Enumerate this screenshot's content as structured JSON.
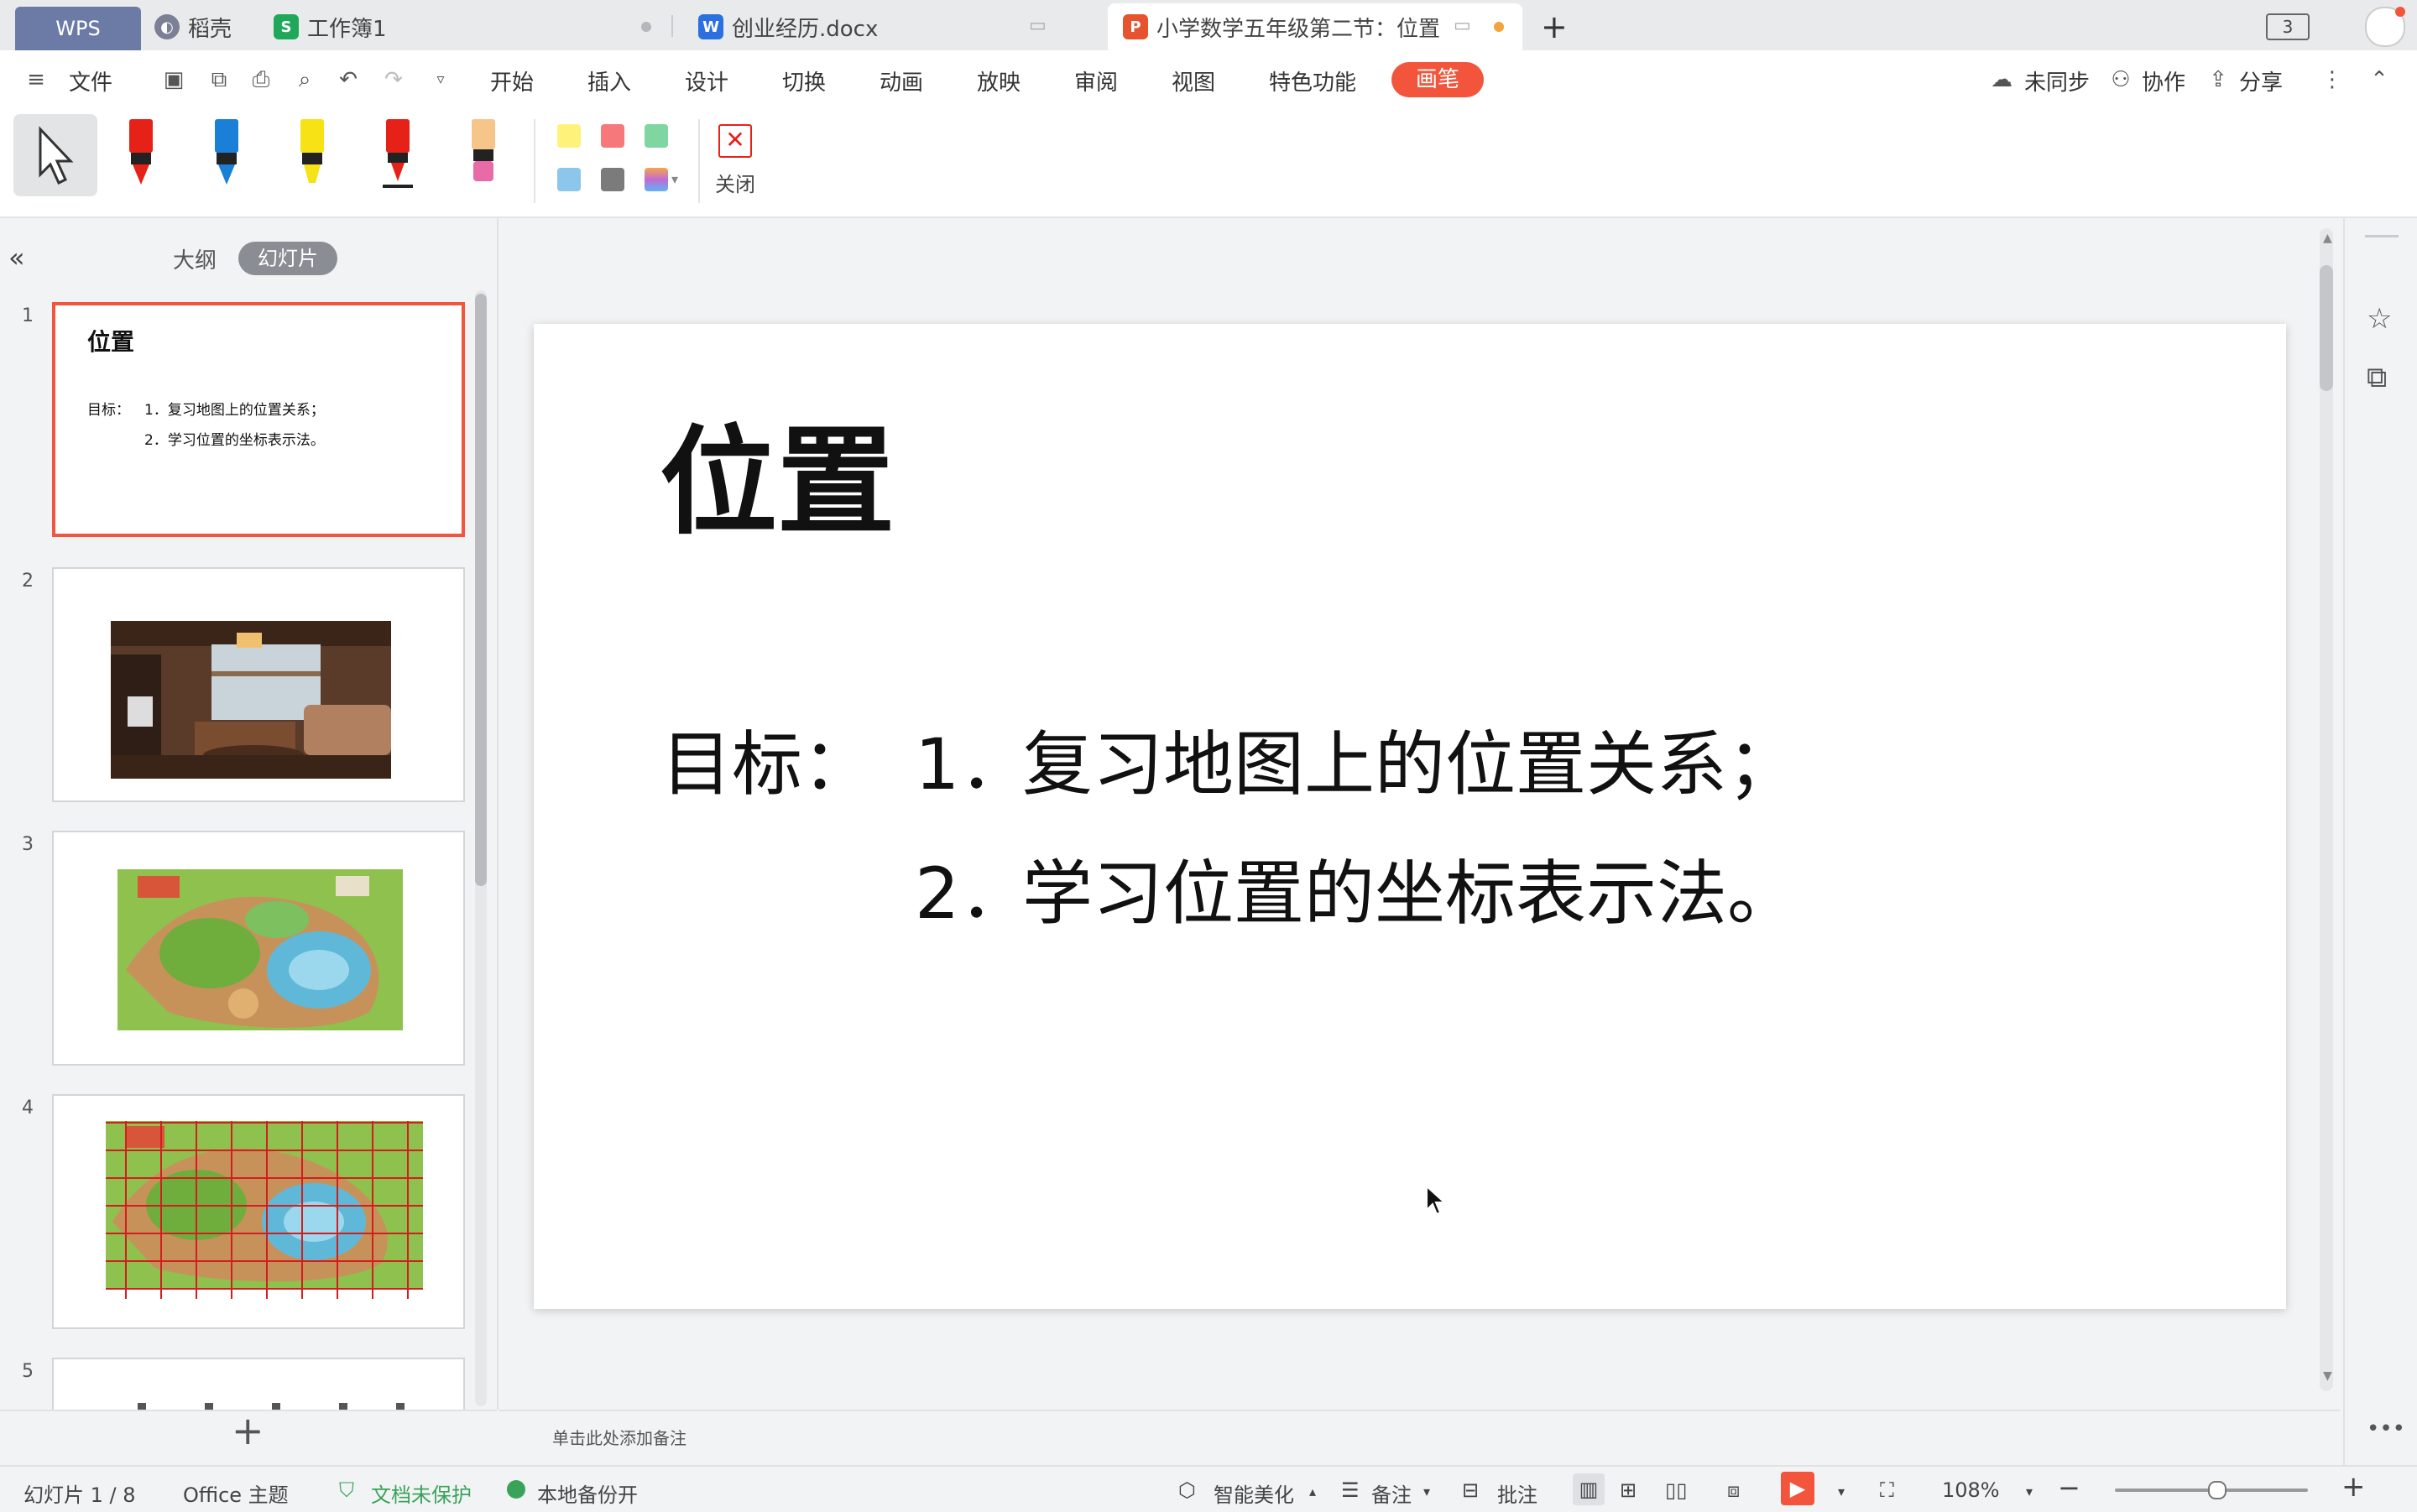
{
  "tabs": {
    "wps": "WPS",
    "daoke": "稻壳",
    "workbook": "工作簿1",
    "docx": "创业经历.docx",
    "active_doc": "小学数学五年级第二节：位置",
    "new_tab": "+",
    "window_count": "3"
  },
  "menu": {
    "file": "文件",
    "items": [
      "开始",
      "插入",
      "设计",
      "切换",
      "动画",
      "放映",
      "审阅",
      "视图",
      "特色功能"
    ],
    "pen": "画笔",
    "sync": "未同步",
    "collab": "协作",
    "share": "分享"
  },
  "ribbon": {
    "close_label": "关闭",
    "pens": [
      {
        "name": "red-marker",
        "color": "#e62117"
      },
      {
        "name": "blue-marker",
        "color": "#1a7fd6"
      },
      {
        "name": "yellow-highlighter",
        "color": "#f7e216"
      },
      {
        "name": "red-pen",
        "color": "#e62117"
      },
      {
        "name": "eraser",
        "color": "#f6c58a"
      }
    ],
    "swatches": [
      "#fff27a",
      "#f6787a",
      "#7fd6a0",
      "#8cc6ea",
      "#7b7b7b"
    ]
  },
  "panel": {
    "collapse_icon": "double-chevron-left-icon",
    "outline_tab": "大纲",
    "slides_tab": "幻灯片",
    "add": "+",
    "thumb1": {
      "title": "位置",
      "goal_label": "目标：",
      "line1": "1．复习地图上的位置关系；",
      "line2": "2．学习位置的坐标表示法。"
    },
    "numbers": [
      "1",
      "2",
      "3",
      "4",
      "5"
    ]
  },
  "slide": {
    "title": "位置",
    "goal_label": "目标：",
    "line1_num": "1．",
    "line1_text": "复习地图上的位置关系；",
    "line2_num": "2．",
    "line2_text": "学习位置的坐标表示法。"
  },
  "notes_placeholder": "单击此处添加备注",
  "status": {
    "slide_counter": "幻灯片 1 / 8",
    "theme": "Office 主题",
    "protect": "文档未保护",
    "backup": "本地备份开",
    "beautify": "智能美化",
    "notes": "备注",
    "comments": "批注",
    "zoom": "108%",
    "zoom_fraction": 0.52,
    "minus": "−",
    "plus": "+"
  }
}
